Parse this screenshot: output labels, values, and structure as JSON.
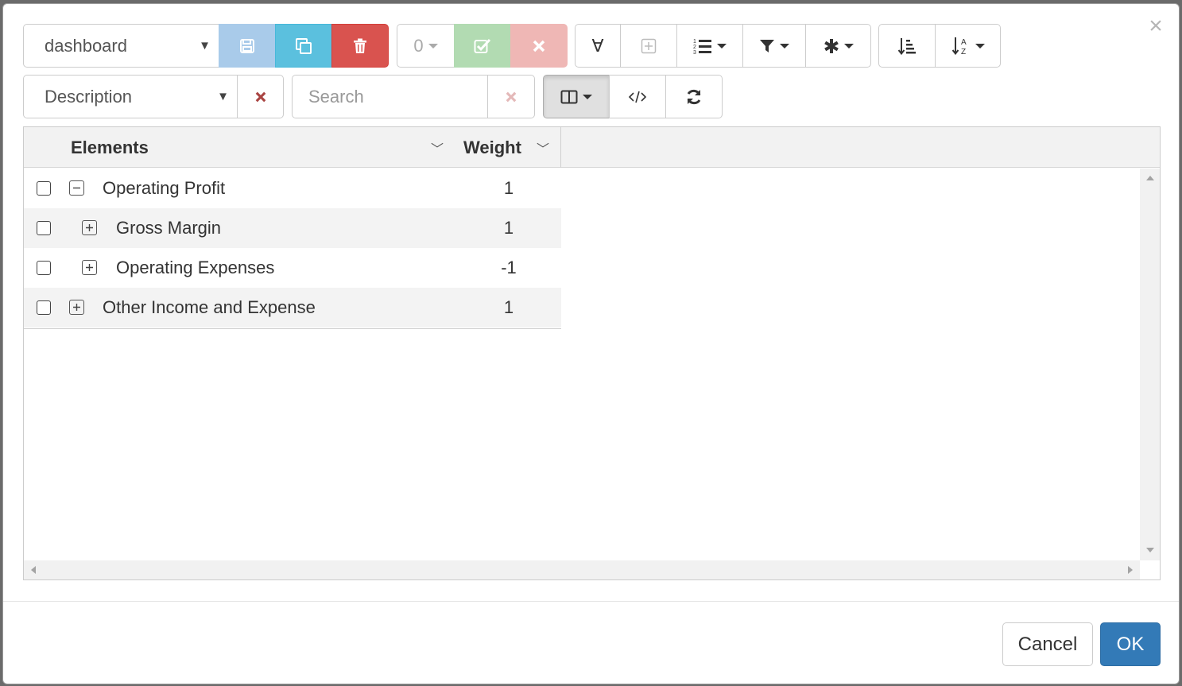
{
  "toolbar": {
    "view_select": "dashboard",
    "counter_value": "0",
    "search_placeholder": "Search",
    "attribute_select": "Description",
    "any_symbol": "∀"
  },
  "grid": {
    "columns": [
      "Elements",
      "Weight"
    ],
    "rows": [
      {
        "label": "Operating Profit",
        "weight": "1",
        "expanded": true,
        "level": 0
      },
      {
        "label": "Gross Margin",
        "weight": "1",
        "expanded": false,
        "level": 1
      },
      {
        "label": "Operating Expenses",
        "weight": "-1",
        "expanded": false,
        "level": 1
      },
      {
        "label": "Other Income and Expense",
        "weight": "1",
        "expanded": false,
        "level": 0
      }
    ]
  },
  "footer": {
    "cancel_label": "Cancel",
    "ok_label": "OK"
  },
  "colors": {
    "save": "#a9cbea",
    "copy": "#5bc0de",
    "delete": "#d9534f",
    "confirm": "#b2dbb2",
    "discard": "#efb7b5",
    "ok": "#337ab7"
  },
  "close_symbol": "×"
}
